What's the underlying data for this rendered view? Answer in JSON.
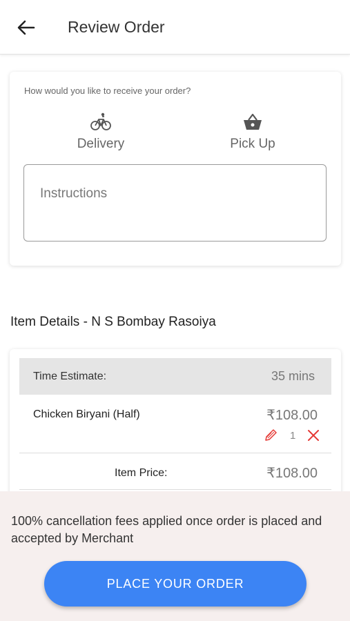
{
  "header": {
    "back_icon": "arrow-left-icon",
    "title": "Review Order"
  },
  "receive_card": {
    "prompt": "How would you like to receive your order?",
    "options": [
      {
        "label": "Delivery",
        "icon": "bicycle-icon"
      },
      {
        "label": "Pick Up",
        "icon": "basket-icon"
      }
    ],
    "instructions_placeholder": "Instructions"
  },
  "item_details": {
    "title": "Item Details - N S Bombay Rasoiya",
    "time_estimate_label": "Time Estimate:",
    "time_estimate_value": "35 mins",
    "items": [
      {
        "name": "Chicken Biryani (Half)",
        "price": "₹108.00",
        "quantity": "1"
      }
    ],
    "item_price_label": "Item Price:",
    "item_price_value": "₹108.00"
  },
  "footer": {
    "notice": "100% cancellation fees applied once order is placed and accepted by Merchant",
    "button_label": "PLACE YOUR ORDER"
  },
  "colors": {
    "accent": "#3c84f4",
    "danger": "#e53935",
    "footer_bg": "#f6efee"
  }
}
